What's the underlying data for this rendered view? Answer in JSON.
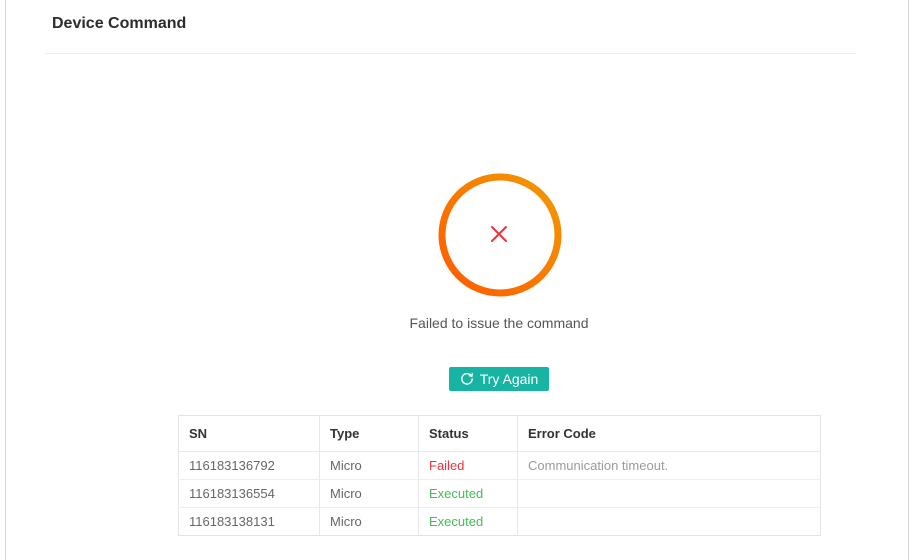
{
  "page": {
    "title": "Device Command"
  },
  "result": {
    "icon": "error-x-icon",
    "message": "Failed to issue the command",
    "ring_color_start": "#ff6a00",
    "ring_color_end": "#f0a000",
    "x_color": "#f0333b"
  },
  "retry": {
    "label": "Try Again",
    "icon": "refresh-icon",
    "color": "#17b3a3"
  },
  "table": {
    "columns": [
      "SN",
      "Type",
      "Status",
      "Error Code"
    ],
    "rows": [
      {
        "sn": "116183136792",
        "type": "Micro",
        "status": "Failed",
        "error_code": "Communication timeout."
      },
      {
        "sn": "116183136554",
        "type": "Micro",
        "status": "Executed",
        "error_code": ""
      },
      {
        "sn": "116183138131",
        "type": "Micro",
        "status": "Executed",
        "error_code": ""
      }
    ]
  },
  "status_colors": {
    "Failed": "#f0333b",
    "Executed": "#3fbf55"
  }
}
